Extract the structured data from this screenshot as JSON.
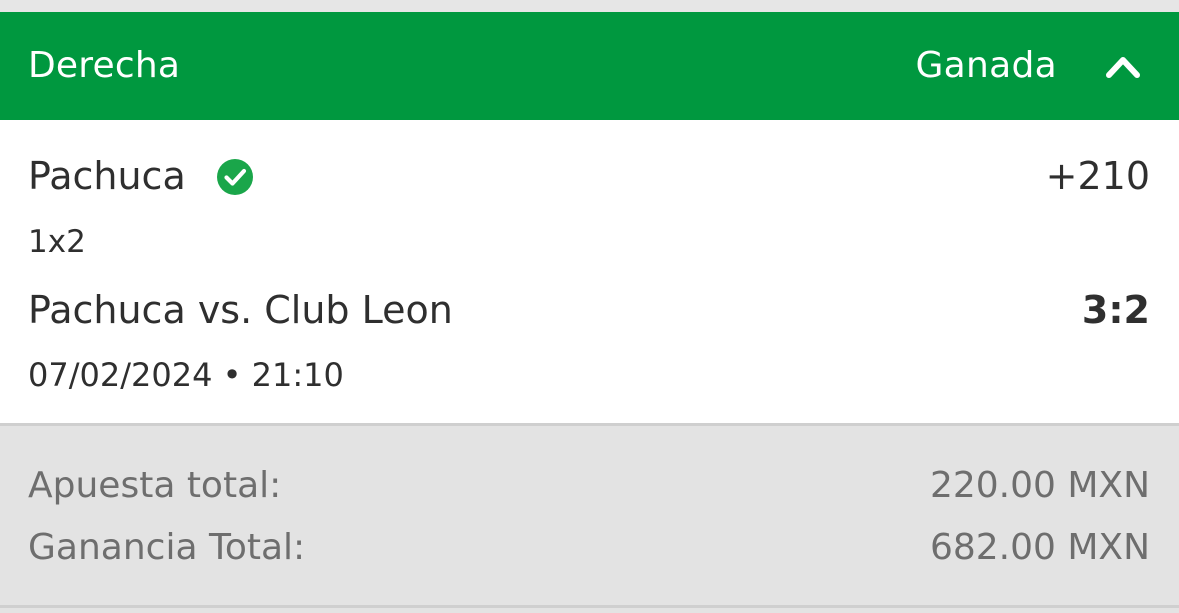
{
  "header": {
    "title": "Derecha",
    "status": "Ganada",
    "chevron_icon": "chevron-up-icon",
    "background_color": "#00983f"
  },
  "selection": {
    "name": "Pachuca",
    "status_icon": "check-circle-icon",
    "status_icon_color": "#1aa64a",
    "odds": "+210"
  },
  "market": "1x2",
  "match": {
    "name": "Pachuca vs. Club Leon",
    "score": "3:2",
    "datetime": "07/02/2024 • 21:10"
  },
  "summary": {
    "total_stake_label": "Apuesta total:",
    "total_stake_value": "220.00 MXN",
    "total_win_label": "Ganancia Total:",
    "total_win_value": "682.00 MXN"
  }
}
